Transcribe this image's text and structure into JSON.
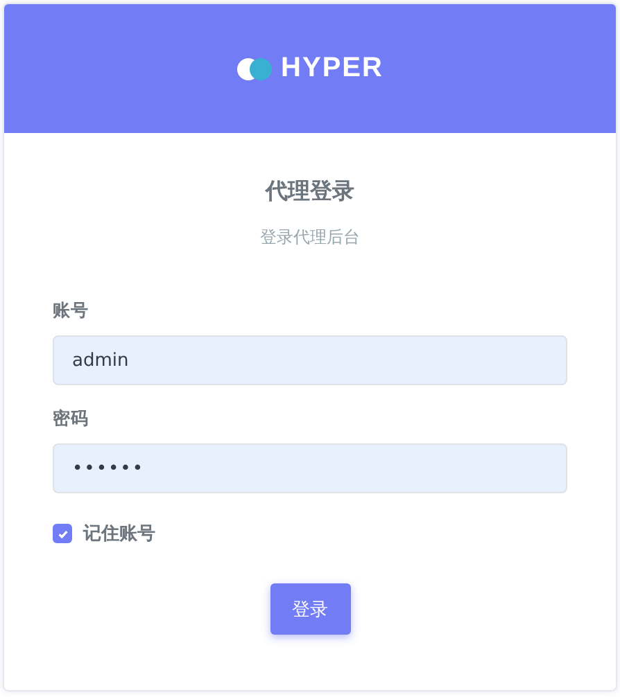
{
  "header": {
    "logo_text": "HYPER"
  },
  "title": "代理登录",
  "subtitle": "登录代理后台",
  "fields": [
    {
      "label": "账号",
      "kind": "text",
      "value": "admin"
    },
    {
      "label": "密码",
      "kind": "password",
      "value": "••••••"
    }
  ],
  "remember": {
    "label": "记住账号",
    "checked": true
  },
  "submit": {
    "label": "登录"
  }
}
